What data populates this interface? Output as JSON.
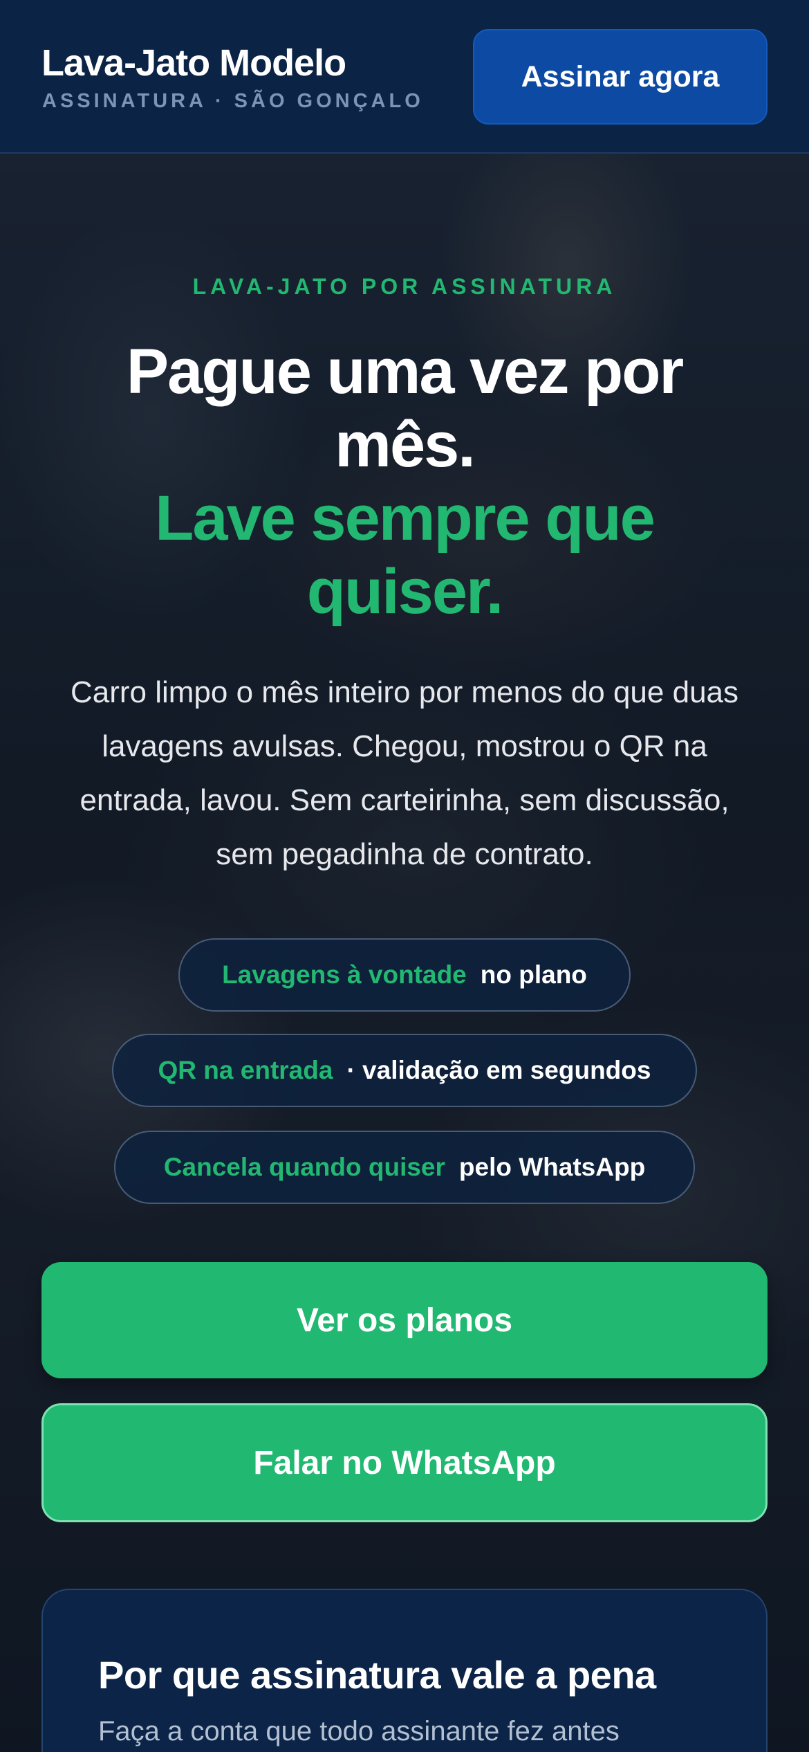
{
  "header": {
    "brand_name": "Lava-Jato Modelo",
    "brand_sub": "ASSINATURA · SÃO GONÇALO",
    "cta_label": "Assinar agora"
  },
  "hero": {
    "eyebrow": "LAVA-JATO POR ASSINATURA",
    "headline_line1": "Pague uma vez por mês.",
    "headline_line2": "Lave sempre que quiser.",
    "lead": "Carro limpo o mês inteiro por menos do que duas lavagens avulsas. Chegou, mostrou o QR na entrada, lavou. Sem carteirinha, sem discussão, sem pegadinha de contrato.",
    "pills": [
      {
        "highlight": "Lavagens à vontade",
        "rest": "no plano"
      },
      {
        "highlight": "QR na entrada",
        "rest": "· validação em segundos"
      },
      {
        "highlight": "Cancela quando quiser",
        "rest": "pelo WhatsApp"
      }
    ],
    "primary_button": "Ver os planos",
    "secondary_button": "Falar no WhatsApp"
  },
  "why_card": {
    "title": "Por que assinatura vale a pena",
    "subtitle": "Faça a conta que todo assinante fez antes"
  },
  "colors": {
    "header_bg": "#0b2345",
    "accent_green": "#22b872",
    "cta_blue": "#0c4aa3",
    "card_bg": "#0c2447"
  }
}
